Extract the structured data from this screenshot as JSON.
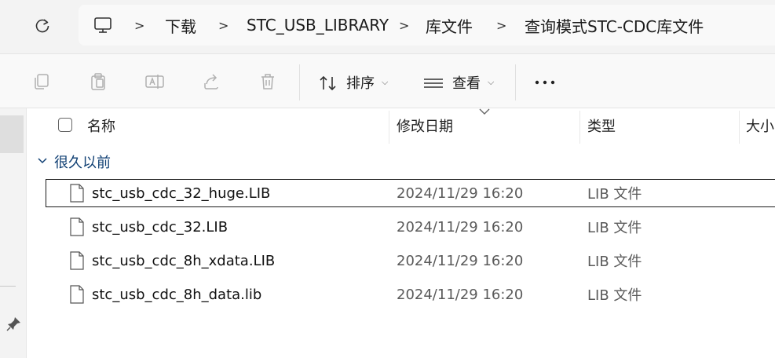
{
  "address_bar": {
    "breadcrumbs": [
      "下载",
      "STC_USB_LIBRARY",
      "库文件",
      "查询模式STC-CDC库文件"
    ]
  },
  "toolbar": {
    "sort_label": "排序",
    "view_label": "查看",
    "more_label": "···"
  },
  "columns": {
    "name": "名称",
    "date": "修改日期",
    "type": "类型",
    "size": "大小"
  },
  "group": {
    "label": "很久以前"
  },
  "files": [
    {
      "name": "stc_usb_cdc_32_huge.LIB",
      "date": "2024/11/29 16:20",
      "type": "LIB 文件",
      "selected": true
    },
    {
      "name": "stc_usb_cdc_32.LIB",
      "date": "2024/11/29 16:20",
      "type": "LIB 文件",
      "selected": false
    },
    {
      "name": "stc_usb_cdc_8h_xdata.LIB",
      "date": "2024/11/29 16:20",
      "type": "LIB 文件",
      "selected": false
    },
    {
      "name": "stc_usb_cdc_8h_data.lib",
      "date": "2024/11/29 16:20",
      "type": "LIB 文件",
      "selected": false
    }
  ],
  "colors": {
    "group_label": "#0f3f73",
    "icon_disabled": "#b0b0b0"
  }
}
